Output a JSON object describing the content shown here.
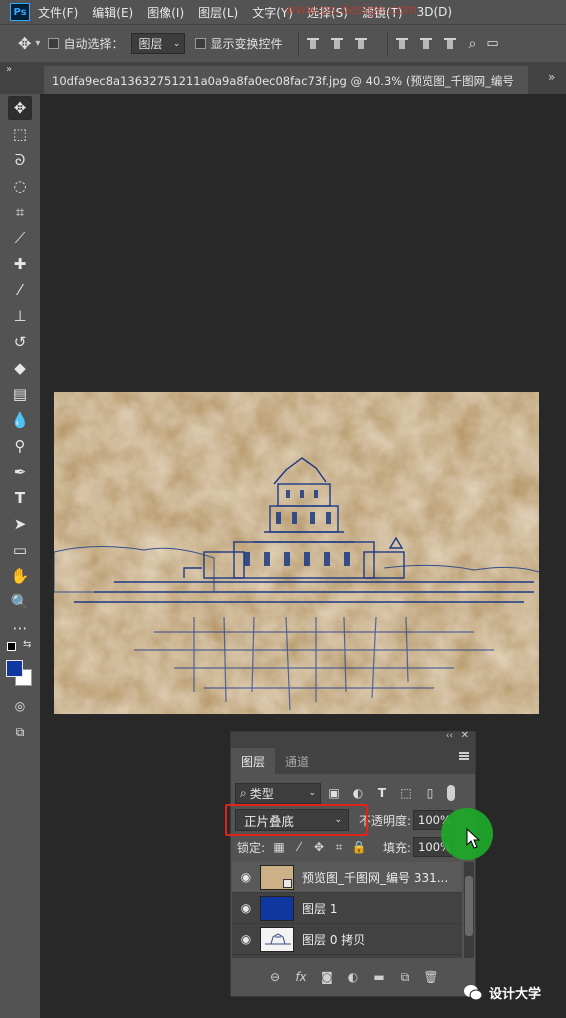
{
  "menubar": {
    "logo": "Ps",
    "items": [
      "文件(F)",
      "编辑(E)",
      "图像(I)",
      "图层(L)",
      "文字(Y)",
      "选择(S)",
      "滤镜(T)",
      "3D(D)"
    ],
    "watermark": "www.ps.design.com"
  },
  "options": {
    "auto_select_label": "自动选择：",
    "auto_select_value": "图层",
    "show_transform_label": "显示变换控件"
  },
  "document": {
    "tab_title": "10dfa9ec8a13632751211a0a9a8fa0ec08fac73f.jpg @ 40.3% (预览图_千图网_编号"
  },
  "colors": {
    "foreground": "#10369f",
    "background": "#ffffff",
    "highlight": "#e0241b",
    "cursor_dot": "#1fa82a"
  },
  "layers_panel": {
    "tabs": [
      "图层",
      "通道"
    ],
    "filter_label": "类型",
    "blend_mode": "正片叠底",
    "opacity_label": "不透明度:",
    "opacity_value": "100%",
    "lock_label": "锁定:",
    "fill_label": "填充:",
    "fill_value": "100%",
    "layers": [
      {
        "name": "预览图_千图网_编号 331...",
        "thumb": "paper",
        "visible": true,
        "selected": true
      },
      {
        "name": "图层 1",
        "thumb": "blue",
        "visible": true,
        "selected": false
      },
      {
        "name": "图层 0 拷贝",
        "thumb": "sketch",
        "visible": true,
        "selected": false
      }
    ],
    "bottom_icons": [
      "link-icon",
      "fx-icon",
      "mask-icon",
      "adjustment-icon",
      "folder-icon",
      "new-layer-icon",
      "trash-icon"
    ],
    "fx_label": "fx"
  },
  "brand": {
    "name": "设计大学"
  }
}
